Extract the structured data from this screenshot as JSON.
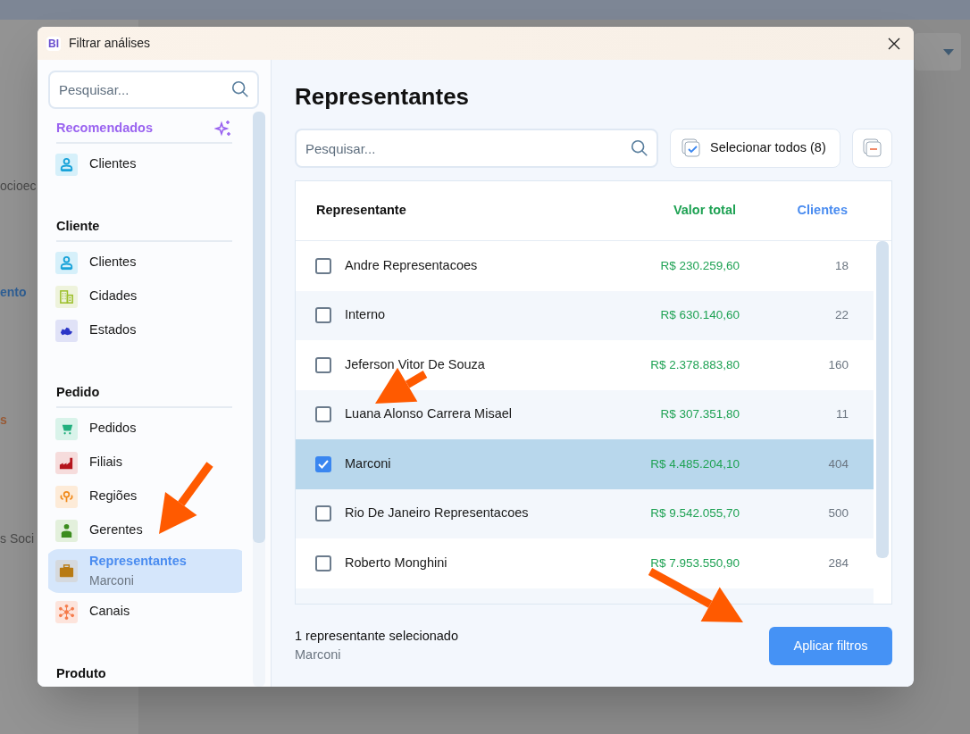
{
  "background": {
    "texts": [
      {
        "text": "ocioec",
        "kind": "plain"
      },
      {
        "text": "ento",
        "kind": "link"
      },
      {
        "text": "s",
        "kind": "accent"
      },
      {
        "text": "s Soci",
        "kind": "plain"
      }
    ]
  },
  "dialog": {
    "logo": "BI",
    "title": "Filtrar análises",
    "search": {
      "placeholder": "Pesquisar..."
    },
    "sections": [
      {
        "title": "Recomendados",
        "kind": "recommended",
        "items": [
          {
            "label": "Clientes",
            "kind": "person",
            "selected": false
          }
        ]
      },
      {
        "title": "Cliente",
        "kind": "group",
        "items": [
          {
            "label": "Clientes",
            "kind": "person",
            "selected": false
          },
          {
            "label": "Cidades",
            "kind": "building",
            "selected": false
          },
          {
            "label": "Estados",
            "kind": "map",
            "selected": false
          }
        ]
      },
      {
        "title": "Pedido",
        "kind": "group",
        "items": [
          {
            "label": "Pedidos",
            "kind": "cart",
            "selected": false
          },
          {
            "label": "Filiais",
            "kind": "factory",
            "selected": false
          },
          {
            "label": "Regiões",
            "kind": "pin",
            "selected": false
          },
          {
            "label": "Gerentes",
            "kind": "manager",
            "selected": false
          },
          {
            "label": "Representantes",
            "kind": "briefcase",
            "selected": true,
            "detail": "Marconi"
          },
          {
            "label": "Canais",
            "kind": "network",
            "selected": false
          }
        ]
      },
      {
        "title": "Produto",
        "kind": "group"
      }
    ],
    "main": {
      "title": "Representantes",
      "search": {
        "placeholder": "Pesquisar..."
      },
      "select_all": "Selecionar todos (8)",
      "table": {
        "columns": [
          "Representante",
          "Valor total",
          "Clientes"
        ],
        "rows": [
          {
            "name": "Andre Representacoes",
            "value": "R$ 230.259,60",
            "clients": "18",
            "checked": false
          },
          {
            "name": "Interno",
            "value": "R$ 630.140,60",
            "clients": "22",
            "checked": false
          },
          {
            "name": "Jeferson Vitor De Souza",
            "value": "R$ 2.378.883,80",
            "clients": "160",
            "checked": false
          },
          {
            "name": "Luana Alonso Carrera Misael",
            "value": "R$ 307.351,80",
            "clients": "11",
            "checked": false
          },
          {
            "name": "Marconi",
            "value": "R$ 4.485.204,10",
            "clients": "404",
            "checked": true
          },
          {
            "name": "Rio De Janeiro Representacoes",
            "value": "R$ 9.542.055,70",
            "clients": "500",
            "checked": false
          },
          {
            "name": "Roberto Monghini",
            "value": "R$ 7.953.550,90",
            "clients": "284",
            "checked": false
          }
        ]
      },
      "footer": {
        "summary": "1 representante selecionado",
        "detail": "Marconi",
        "apply": "Aplicar filtros"
      }
    }
  }
}
